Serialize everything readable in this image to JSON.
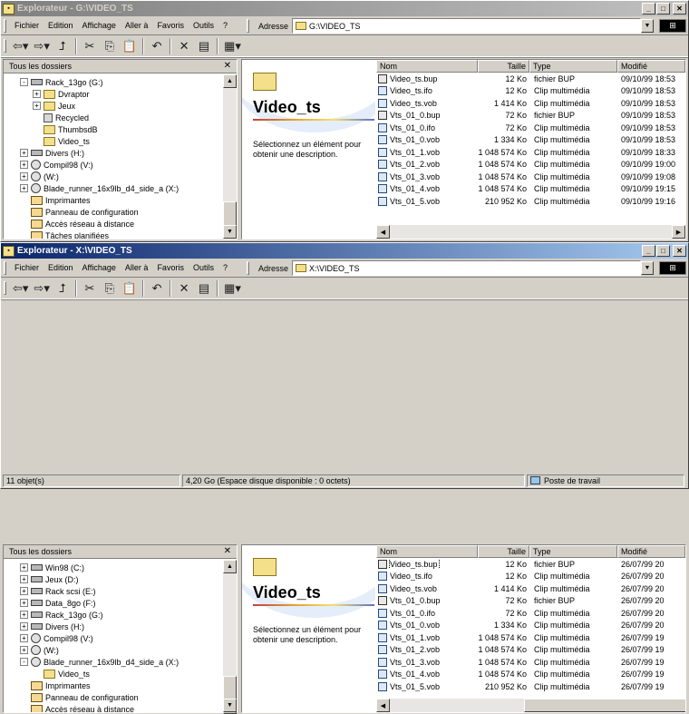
{
  "menu": [
    "Fichier",
    "Edition",
    "Affichage",
    "Aller à",
    "Favoris",
    "Outils",
    "?"
  ],
  "address_label": "Adresse",
  "tree_header": "Tous les dossiers",
  "folder_title": "Video_ts",
  "description": "Sélectionnez un élément pour obtenir une description.",
  "columns": {
    "name": "Nom",
    "size": "Taille",
    "type": "Type",
    "modified": "Modifié"
  },
  "window1": {
    "title": "Explorateur - G:\\VIDEO_TS",
    "address": "G:\\VIDEO_TS",
    "tree": [
      {
        "label": "Rack_13go (G:)",
        "icon": "drive",
        "exp": "-",
        "indent": 0
      },
      {
        "label": "Dvraptor",
        "icon": "folder",
        "exp": "+",
        "indent": 1
      },
      {
        "label": "Jeux",
        "icon": "folder",
        "exp": "+",
        "indent": 1
      },
      {
        "label": "Recycled",
        "icon": "recycle-bin",
        "exp": "",
        "indent": 1
      },
      {
        "label": "ThumbsdB",
        "icon": "folder",
        "exp": "",
        "indent": 1
      },
      {
        "label": "Video_ts",
        "icon": "folder",
        "exp": "",
        "indent": 1
      },
      {
        "label": "Divers (H:)",
        "icon": "drive",
        "exp": "+",
        "indent": 0
      },
      {
        "label": "Compil98 (V:)",
        "icon": "cd",
        "exp": "+",
        "indent": 0
      },
      {
        "label": "(W:)",
        "icon": "cd",
        "exp": "+",
        "indent": 0
      },
      {
        "label": "Blade_runner_16x9lb_d4_side_a (X:)",
        "icon": "cd",
        "exp": "+",
        "indent": 0
      },
      {
        "label": "Imprimantes",
        "icon": "system",
        "exp": "",
        "indent": 0
      },
      {
        "label": "Panneau de configuration",
        "icon": "system",
        "exp": "",
        "indent": 0
      },
      {
        "label": "Accès réseau à distance",
        "icon": "system",
        "exp": "",
        "indent": 0
      },
      {
        "label": "Tâches planifiées",
        "icon": "system",
        "exp": "",
        "indent": 0
      }
    ],
    "files": [
      {
        "name": "Video_ts.bup",
        "size": "12 Ko",
        "type": "fichier BUP",
        "modified": "09/10/99 18:53",
        "icon": "file"
      },
      {
        "name": "Video_ts.ifo",
        "size": "12 Ko",
        "type": "Clip multimédia",
        "modified": "09/10/99 18:53",
        "icon": "media"
      },
      {
        "name": "Video_ts.vob",
        "size": "1 414 Ko",
        "type": "Clip multimédia",
        "modified": "09/10/99 18:53",
        "icon": "media"
      },
      {
        "name": "Vts_01_0.bup",
        "size": "72 Ko",
        "type": "fichier BUP",
        "modified": "09/10/99 18:53",
        "icon": "file"
      },
      {
        "name": "Vts_01_0.ifo",
        "size": "72 Ko",
        "type": "Clip multimédia",
        "modified": "09/10/99 18:53",
        "icon": "media"
      },
      {
        "name": "Vts_01_0.vob",
        "size": "1 334 Ko",
        "type": "Clip multimédia",
        "modified": "09/10/99 18:53",
        "icon": "media"
      },
      {
        "name": "Vts_01_1.vob",
        "size": "1 048 574 Ko",
        "type": "Clip multimédia",
        "modified": "09/10/99 18:33",
        "icon": "media"
      },
      {
        "name": "Vts_01_2.vob",
        "size": "1 048 574 Ko",
        "type": "Clip multimédia",
        "modified": "09/10/99 19:00",
        "icon": "media"
      },
      {
        "name": "Vts_01_3.vob",
        "size": "1 048 574 Ko",
        "type": "Clip multimédia",
        "modified": "09/10/99 19:08",
        "icon": "media"
      },
      {
        "name": "Vts_01_4.vob",
        "size": "1 048 574 Ko",
        "type": "Clip multimédia",
        "modified": "09/10/99 19:15",
        "icon": "media"
      },
      {
        "name": "Vts_01_5.vob",
        "size": "210 952 Ko",
        "type": "Clip multimédia",
        "modified": "09/10/99 19:16",
        "icon": "media"
      }
    ]
  },
  "window2": {
    "title": "Explorateur - X:\\VIDEO_TS",
    "address": "X:\\VIDEO_TS",
    "tree": [
      {
        "label": "Win98 (C:)",
        "icon": "drive",
        "exp": "+",
        "indent": 0
      },
      {
        "label": "Jeux (D:)",
        "icon": "drive",
        "exp": "+",
        "indent": 0
      },
      {
        "label": "Rack scsi (E:)",
        "icon": "drive",
        "exp": "+",
        "indent": 0
      },
      {
        "label": "Data_8go (F:)",
        "icon": "drive",
        "exp": "+",
        "indent": 0
      },
      {
        "label": "Rack_13go (G:)",
        "icon": "drive",
        "exp": "+",
        "indent": 0
      },
      {
        "label": "Divers (H:)",
        "icon": "drive",
        "exp": "+",
        "indent": 0
      },
      {
        "label": "Compil98 (V:)",
        "icon": "cd",
        "exp": "+",
        "indent": 0
      },
      {
        "label": "(W:)",
        "icon": "cd",
        "exp": "+",
        "indent": 0
      },
      {
        "label": "Blade_runner_16x9lb_d4_side_a (X:)",
        "icon": "cd",
        "exp": "-",
        "indent": 0
      },
      {
        "label": "Video_ts",
        "icon": "folder",
        "exp": "",
        "indent": 1
      },
      {
        "label": "Imprimantes",
        "icon": "system",
        "exp": "",
        "indent": 0
      },
      {
        "label": "Panneau de configuration",
        "icon": "system",
        "exp": "",
        "indent": 0
      },
      {
        "label": "Accès réseau à distance",
        "icon": "system",
        "exp": "",
        "indent": 0
      }
    ],
    "files": [
      {
        "name": "Video_ts.bup",
        "size": "12 Ko",
        "type": "fichier BUP",
        "modified": "26/07/99 20",
        "icon": "file"
      },
      {
        "name": "Video_ts.ifo",
        "size": "12 Ko",
        "type": "Clip multimédia",
        "modified": "26/07/99 20",
        "icon": "media"
      },
      {
        "name": "Video_ts.vob",
        "size": "1 414 Ko",
        "type": "Clip multimédia",
        "modified": "26/07/99 20",
        "icon": "media"
      },
      {
        "name": "Vts_01_0.bup",
        "size": "72 Ko",
        "type": "fichier BUP",
        "modified": "26/07/99 20",
        "icon": "file"
      },
      {
        "name": "Vts_01_0.ifo",
        "size": "72 Ko",
        "type": "Clip multimédia",
        "modified": "26/07/99 20",
        "icon": "media"
      },
      {
        "name": "Vts_01_0.vob",
        "size": "1 334 Ko",
        "type": "Clip multimédia",
        "modified": "26/07/99 20",
        "icon": "media"
      },
      {
        "name": "Vts_01_1.vob",
        "size": "1 048 574 Ko",
        "type": "Clip multimédia",
        "modified": "26/07/99 19",
        "icon": "media"
      },
      {
        "name": "Vts_01_2.vob",
        "size": "1 048 574 Ko",
        "type": "Clip multimédia",
        "modified": "26/07/99 19",
        "icon": "media"
      },
      {
        "name": "Vts_01_3.vob",
        "size": "1 048 574 Ko",
        "type": "Clip multimédia",
        "modified": "26/07/99 19",
        "icon": "media"
      },
      {
        "name": "Vts_01_4.vob",
        "size": "1 048 574 Ko",
        "type": "Clip multimédia",
        "modified": "26/07/99 19",
        "icon": "media"
      },
      {
        "name": "Vts_01_5.vob",
        "size": "210 952 Ko",
        "type": "Clip multimédia",
        "modified": "26/07/99 19",
        "icon": "media"
      }
    ],
    "status": {
      "count": "11 objet(s)",
      "space": "4,20 Go (Espace disque disponible : 0 octets)",
      "location": "Poste de travail"
    }
  },
  "colors": {
    "active_title": "#0a246a",
    "inactive_title": "#808080",
    "face": "#d4d0c8"
  }
}
